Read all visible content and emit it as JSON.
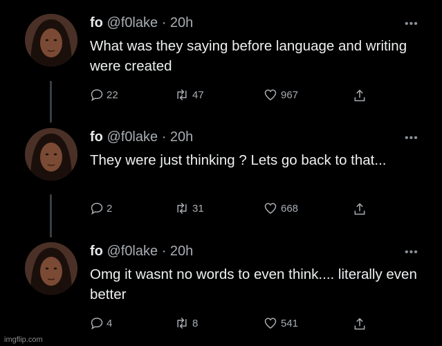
{
  "tweets": [
    {
      "name": "fo",
      "handle": "@f0lake",
      "separator": "·",
      "time": "20h",
      "text": "What was they saying before language and writing were created",
      "replies": "22",
      "retweets": "47",
      "likes": "967"
    },
    {
      "name": "fo",
      "handle": "@f0lake",
      "separator": "·",
      "time": "20h",
      "text": "They were just thinking ? Lets go back to that...",
      "replies": "2",
      "retweets": "31",
      "likes": "668"
    },
    {
      "name": "fo",
      "handle": "@f0lake",
      "separator": "·",
      "time": "20h",
      "text": "Omg it wasnt no words to even think.... literally even better",
      "replies": "4",
      "retweets": "8",
      "likes": "541"
    }
  ],
  "more_label": "•••",
  "watermark": "imgflip.com",
  "icons": {
    "reply": "reply-icon",
    "retweet": "retweet-icon",
    "like": "heart-icon",
    "share": "share-icon",
    "more": "more-icon"
  },
  "colors": {
    "background": "#000000",
    "text": "#e7e9ea",
    "secondary": "#a8adb2",
    "connector": "#3a3d41"
  }
}
